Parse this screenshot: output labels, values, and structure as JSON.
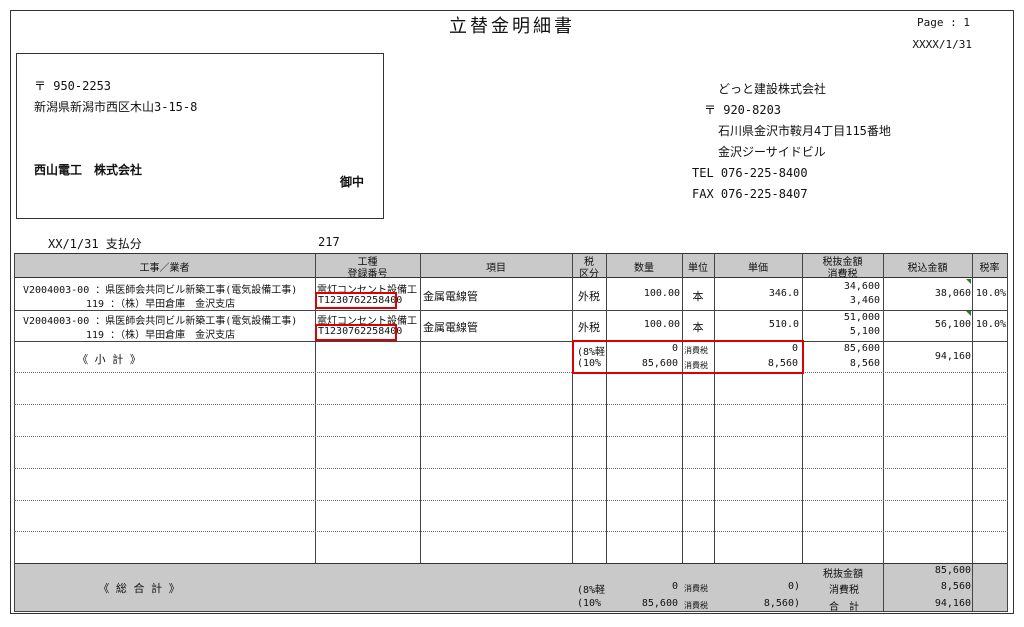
{
  "doc": {
    "title": "立替金明細書",
    "page_label": "Page : 1",
    "date": "XXXX/1/31"
  },
  "recipient": {
    "postal": "〒 950-2253",
    "address": "新潟県新潟市西区木山3-15-8",
    "company": "西山電工　株式会社",
    "honorific": "御中"
  },
  "sender": {
    "company": "どっと建設株式会社",
    "postal": "〒 920-8203",
    "address1": "石川県金沢市鞍月4丁目115番地",
    "address2": "金沢ジーサイドビル",
    "tel": "TEL 076-225-8400",
    "fax": "FAX 076-225-8407"
  },
  "payment": {
    "label": "XX/1/31 支払分",
    "number": "217"
  },
  "table": {
    "headers": {
      "project": "工事／業者",
      "trade_line1": "工種",
      "trade_line2": "登録番号",
      "item": "項目",
      "tax_line1": "税",
      "tax_line2": "区分",
      "qty": "数量",
      "unit": "単位",
      "price": "単価",
      "amount_line1": "税抜金額",
      "amount_line2": "消費税",
      "total": "税込金額",
      "rate": "税率"
    },
    "rows": [
      {
        "project1": "V2004003-00 ：県医師会共同ビル新築工事(電気設備工事)",
        "project2": "119 ：（株）早田倉庫　金沢支店",
        "trade": "電灯コンセント設備工",
        "reg_no": "T1230762258400",
        "item": "金属電線管",
        "tax": "外税",
        "qty": "100.00",
        "unit": "本",
        "price": "346.0",
        "amount": "34,600",
        "tax_amt": "3,460",
        "total": "38,060",
        "rate": "10.0%"
      },
      {
        "project1": "V2004003-00 ：県医師会共同ビル新築工事(電気設備工事)",
        "project2": "119 ：（株）早田倉庫　金沢支店",
        "trade": "電灯コンセント設備工",
        "reg_no": "T1230762258400",
        "item": "金属電線管",
        "tax": "外税",
        "qty": "100.00",
        "unit": "本",
        "price": "510.0",
        "amount": "51,000",
        "tax_amt": "5,100",
        "total": "56,100",
        "rate": "10.0%"
      }
    ],
    "subtotal": {
      "label": "《 小 計 》",
      "r8_label": "(8%軽",
      "r8_base": "0",
      "r8_tax_label": "消費税",
      "r8_tax": "0",
      "r10_label": "(10%",
      "r10_base": "85,600",
      "r10_tax_label": "消費税",
      "r10_tax": "8,560",
      "amount": "85,600",
      "tax_amt": "8,560",
      "total": "94,160"
    },
    "grand_total": {
      "label": "《 総 合 計 》",
      "r8_label": "(8%軽",
      "r8_base": "0",
      "r8_tax_label": "消費税",
      "r8_tax": "0)",
      "r10_label": "(10%",
      "r10_base": "85,600",
      "r10_tax_label": "消費税",
      "r10_tax": "8,560)",
      "excl_label": "税抜金額",
      "excl_value": "85,600",
      "tax_label": "消費税",
      "tax_value": "8,560",
      "sum_label": "合　計",
      "sum_value": "94,160"
    }
  },
  "colors": {
    "header_bg": "#c9c9c9",
    "highlight": "#dd0000",
    "marker": "#2a7a2a"
  }
}
